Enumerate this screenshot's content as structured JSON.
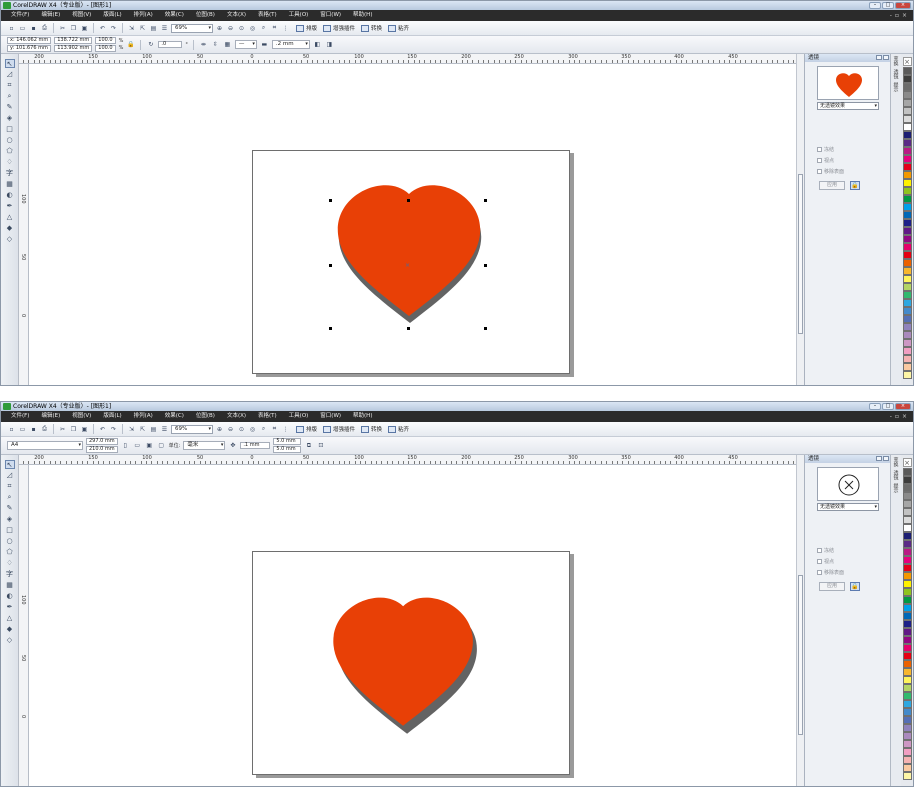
{
  "title": "CorelDRAW X4（专业版）- [图形1]",
  "menu": [
    "文件(F)",
    "编辑(E)",
    "视图(V)",
    "版面(L)",
    "排列(A)",
    "效果(C)",
    "位图(B)",
    "文本(X)",
    "表格(T)",
    "工具(O)",
    "窗口(W)",
    "帮助(H)"
  ],
  "toolbar": {
    "zoom": "69%",
    "buttons": [
      "排版",
      "增强插件",
      "转换",
      "粘齐"
    ]
  },
  "top": {
    "prop": {
      "x": "x: 146.062 mm",
      "y": "y: 101.676 mm",
      "w": "138.722 mm",
      "h": "113.902 mm",
      "sx": "100.0",
      "sy": "100.0",
      "pct1": "%",
      "pct2": "%",
      "rot": ".0",
      "deg": "°",
      "outline": ".2 mm"
    },
    "checks": [
      "冻结",
      "视点",
      "移除表面"
    ],
    "apply": "应用",
    "dropdown": "无透镜效果"
  },
  "bottom": {
    "prop": {
      "paper": "A4",
      "pw": "297.0 mm",
      "ph": "210.0 mm",
      "unit_label": "单位:",
      "unit": "毫米",
      "nudge": ".1 mm",
      "dup1": "5.0 mm",
      "dup2": "5.0 mm"
    },
    "checks": [
      "冻结",
      "视点",
      "移除表面"
    ],
    "apply": "应用",
    "dropdown": "无透镜效果"
  },
  "docker": {
    "title": "透镜"
  },
  "ruler": {
    "h": [
      "200",
      "150",
      "100",
      "50",
      "0",
      "50",
      "100",
      "150",
      "200",
      "250",
      "300",
      "350",
      "400",
      "450"
    ],
    "v": [
      "100",
      "50",
      "0"
    ]
  },
  "docktabs": [
    "变换",
    "透镜",
    "提示"
  ],
  "colors": {
    "heart": "#e84006",
    "shadow": "#636363",
    "palette": [
      "#5a5a5a",
      "#3d3d3d",
      "#6b6b6b",
      "#8a8a8a",
      "#a6a6a6",
      "#c2c2c2",
      "#dcdcdc",
      "#ffffff",
      "#1d1f73",
      "#5b2a86",
      "#b81a85",
      "#e6007e",
      "#e4001a",
      "#f39800",
      "#fff100",
      "#8fc31f",
      "#009944",
      "#00a0e9",
      "#0068b7",
      "#1d2088",
      "#601986",
      "#920783",
      "#e5006a",
      "#e60012",
      "#eb6100",
      "#f8b62d",
      "#fff45c",
      "#b3d465",
      "#31b96e",
      "#2ea7e0",
      "#448aca",
      "#556fb5",
      "#8f82bc",
      "#aa89bd",
      "#cd97c4",
      "#f19ec2",
      "#f5b2b2",
      "#fac9a1",
      "#fdf5a5"
    ]
  }
}
